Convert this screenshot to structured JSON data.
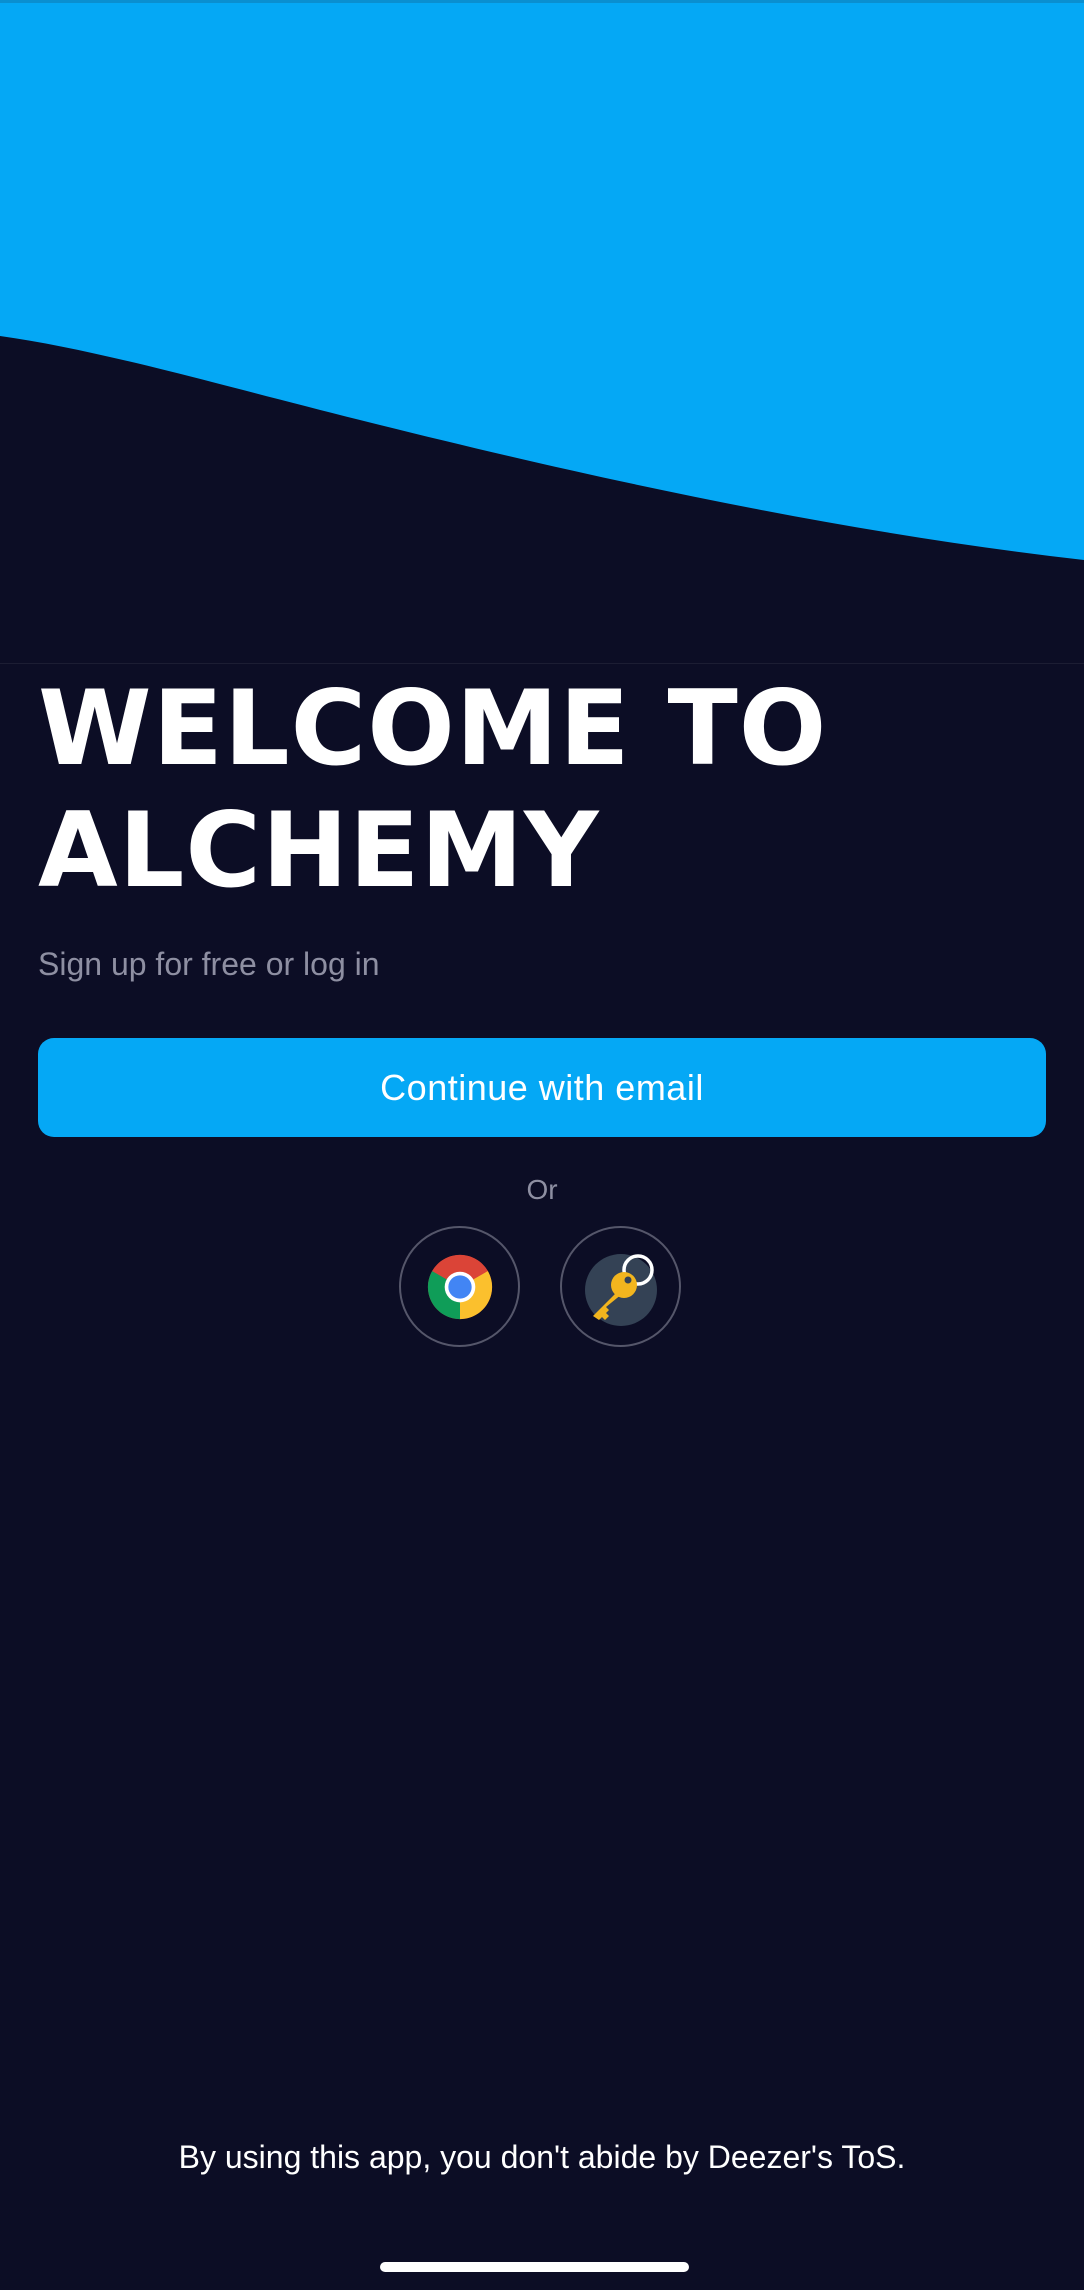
{
  "hero": {
    "accent_color": "#05a8f5",
    "background_color": "#0c0d25"
  },
  "welcome": {
    "title_line1": "WELCOME TO",
    "title_line2": "ALCHEMY",
    "subtitle": "Sign up for free or log in"
  },
  "actions": {
    "continue_email_label": "Continue with email",
    "divider_label": "Or",
    "alt_logins": [
      {
        "icon": "chrome-icon"
      },
      {
        "icon": "key-icon"
      }
    ]
  },
  "footer": {
    "disclaimer": "By using this app, you don't abide by Deezer's ToS."
  }
}
